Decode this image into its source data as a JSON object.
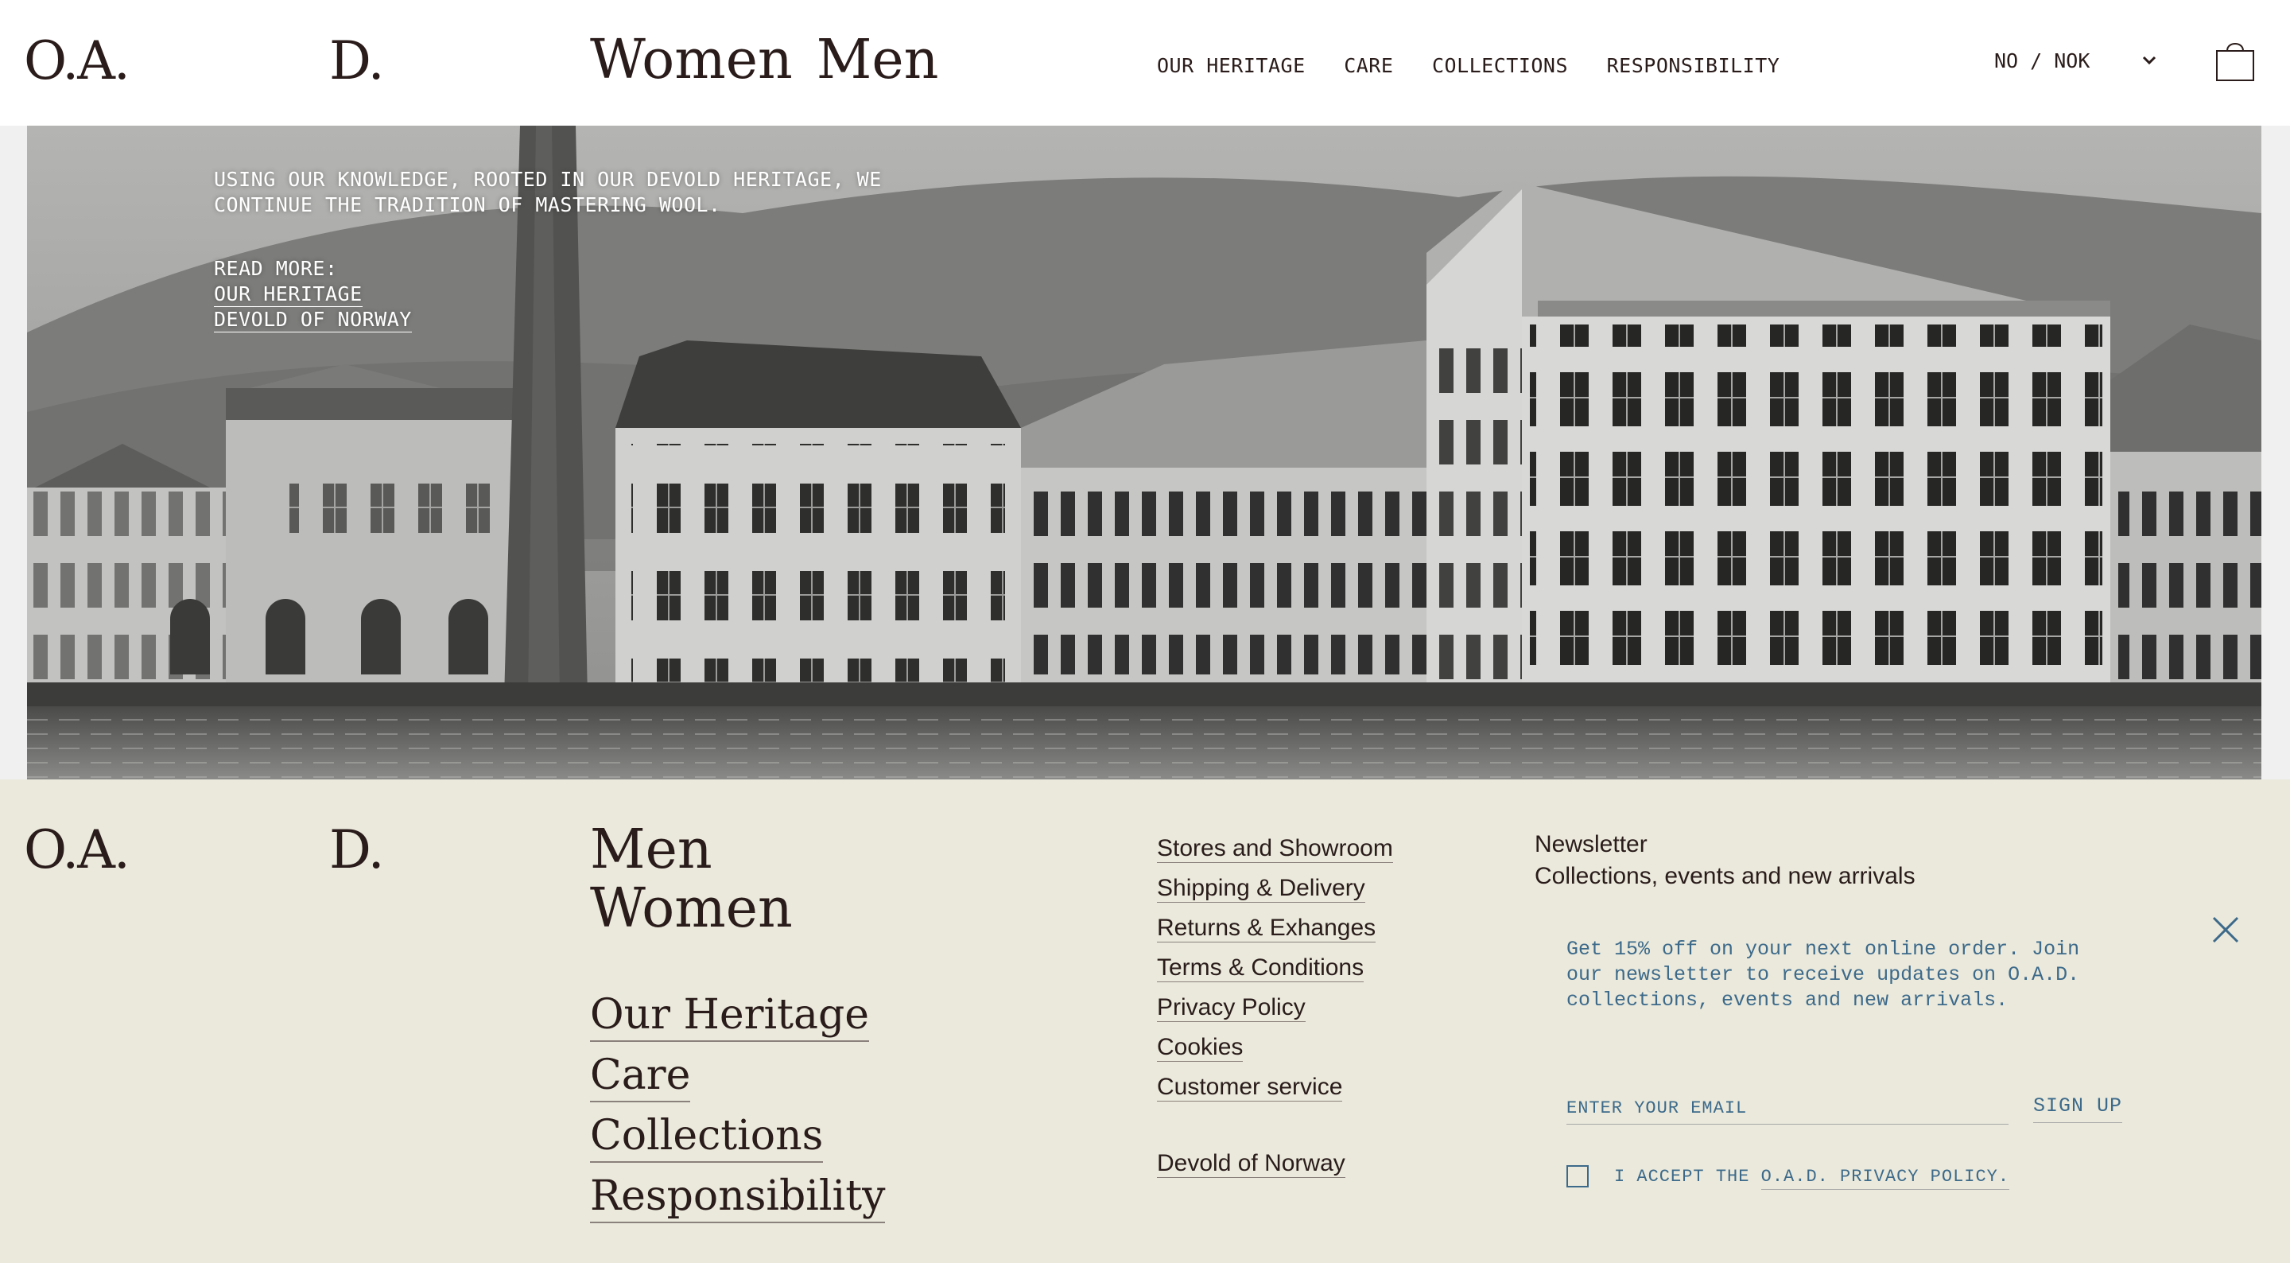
{
  "header": {
    "logo_left": "O.A.",
    "logo_right": "D.",
    "gender_nav": [
      "Women",
      "Men"
    ],
    "main_nav": [
      "OUR HERITAGE",
      "CARE",
      "COLLECTIONS",
      "RESPONSIBILITY"
    ],
    "locale": "NO / NOK",
    "icons": {
      "locale_toggle": "chevron-down-icon",
      "cart": "shopping-bag-icon"
    }
  },
  "hero": {
    "intro": [
      "USING OUR KNOWLEDGE, ROOTED IN OUR DEVOLD HERITAGE, WE",
      "CONTINUE THE TRADITION OF MASTERING WOOL."
    ],
    "read_more_label": "READ MORE:",
    "links": [
      "OUR HERITAGE",
      "DEVOLD OF NORWAY"
    ]
  },
  "footer": {
    "logo_left": "O.A.",
    "logo_right": "D.",
    "gender_links": [
      "Men",
      "Women"
    ],
    "primary_links": [
      "Our Heritage",
      "Care",
      "Collections",
      "Responsibility"
    ],
    "secondary_links": [
      "Stores and Showroom",
      "Shipping & Delivery",
      "Returns & Exhanges",
      "Terms & Conditions",
      "Privacy Policy",
      "Cookies",
      "Customer service"
    ],
    "extra_link": "Devold of Norway",
    "newsletter": {
      "title": "Newsletter",
      "subtitle": "Collections, events and new arrivals",
      "promo": "Get 15% off on your next online order. Join our newsletter to receive updates on O.A.D. collections, events and new arrivals.",
      "email_placeholder": "ENTER YOUR EMAIL",
      "signup_label": "SIGN UP",
      "consent_prefix": "I ACCEPT THE",
      "consent_link": "O.A.D. PRIVACY POLICY.",
      "close_icon": "close-icon"
    }
  },
  "colors": {
    "text": "#2a1c1a",
    "footer_bg": "#eae9dc",
    "newsletter_accent": "#3d6a8a"
  }
}
